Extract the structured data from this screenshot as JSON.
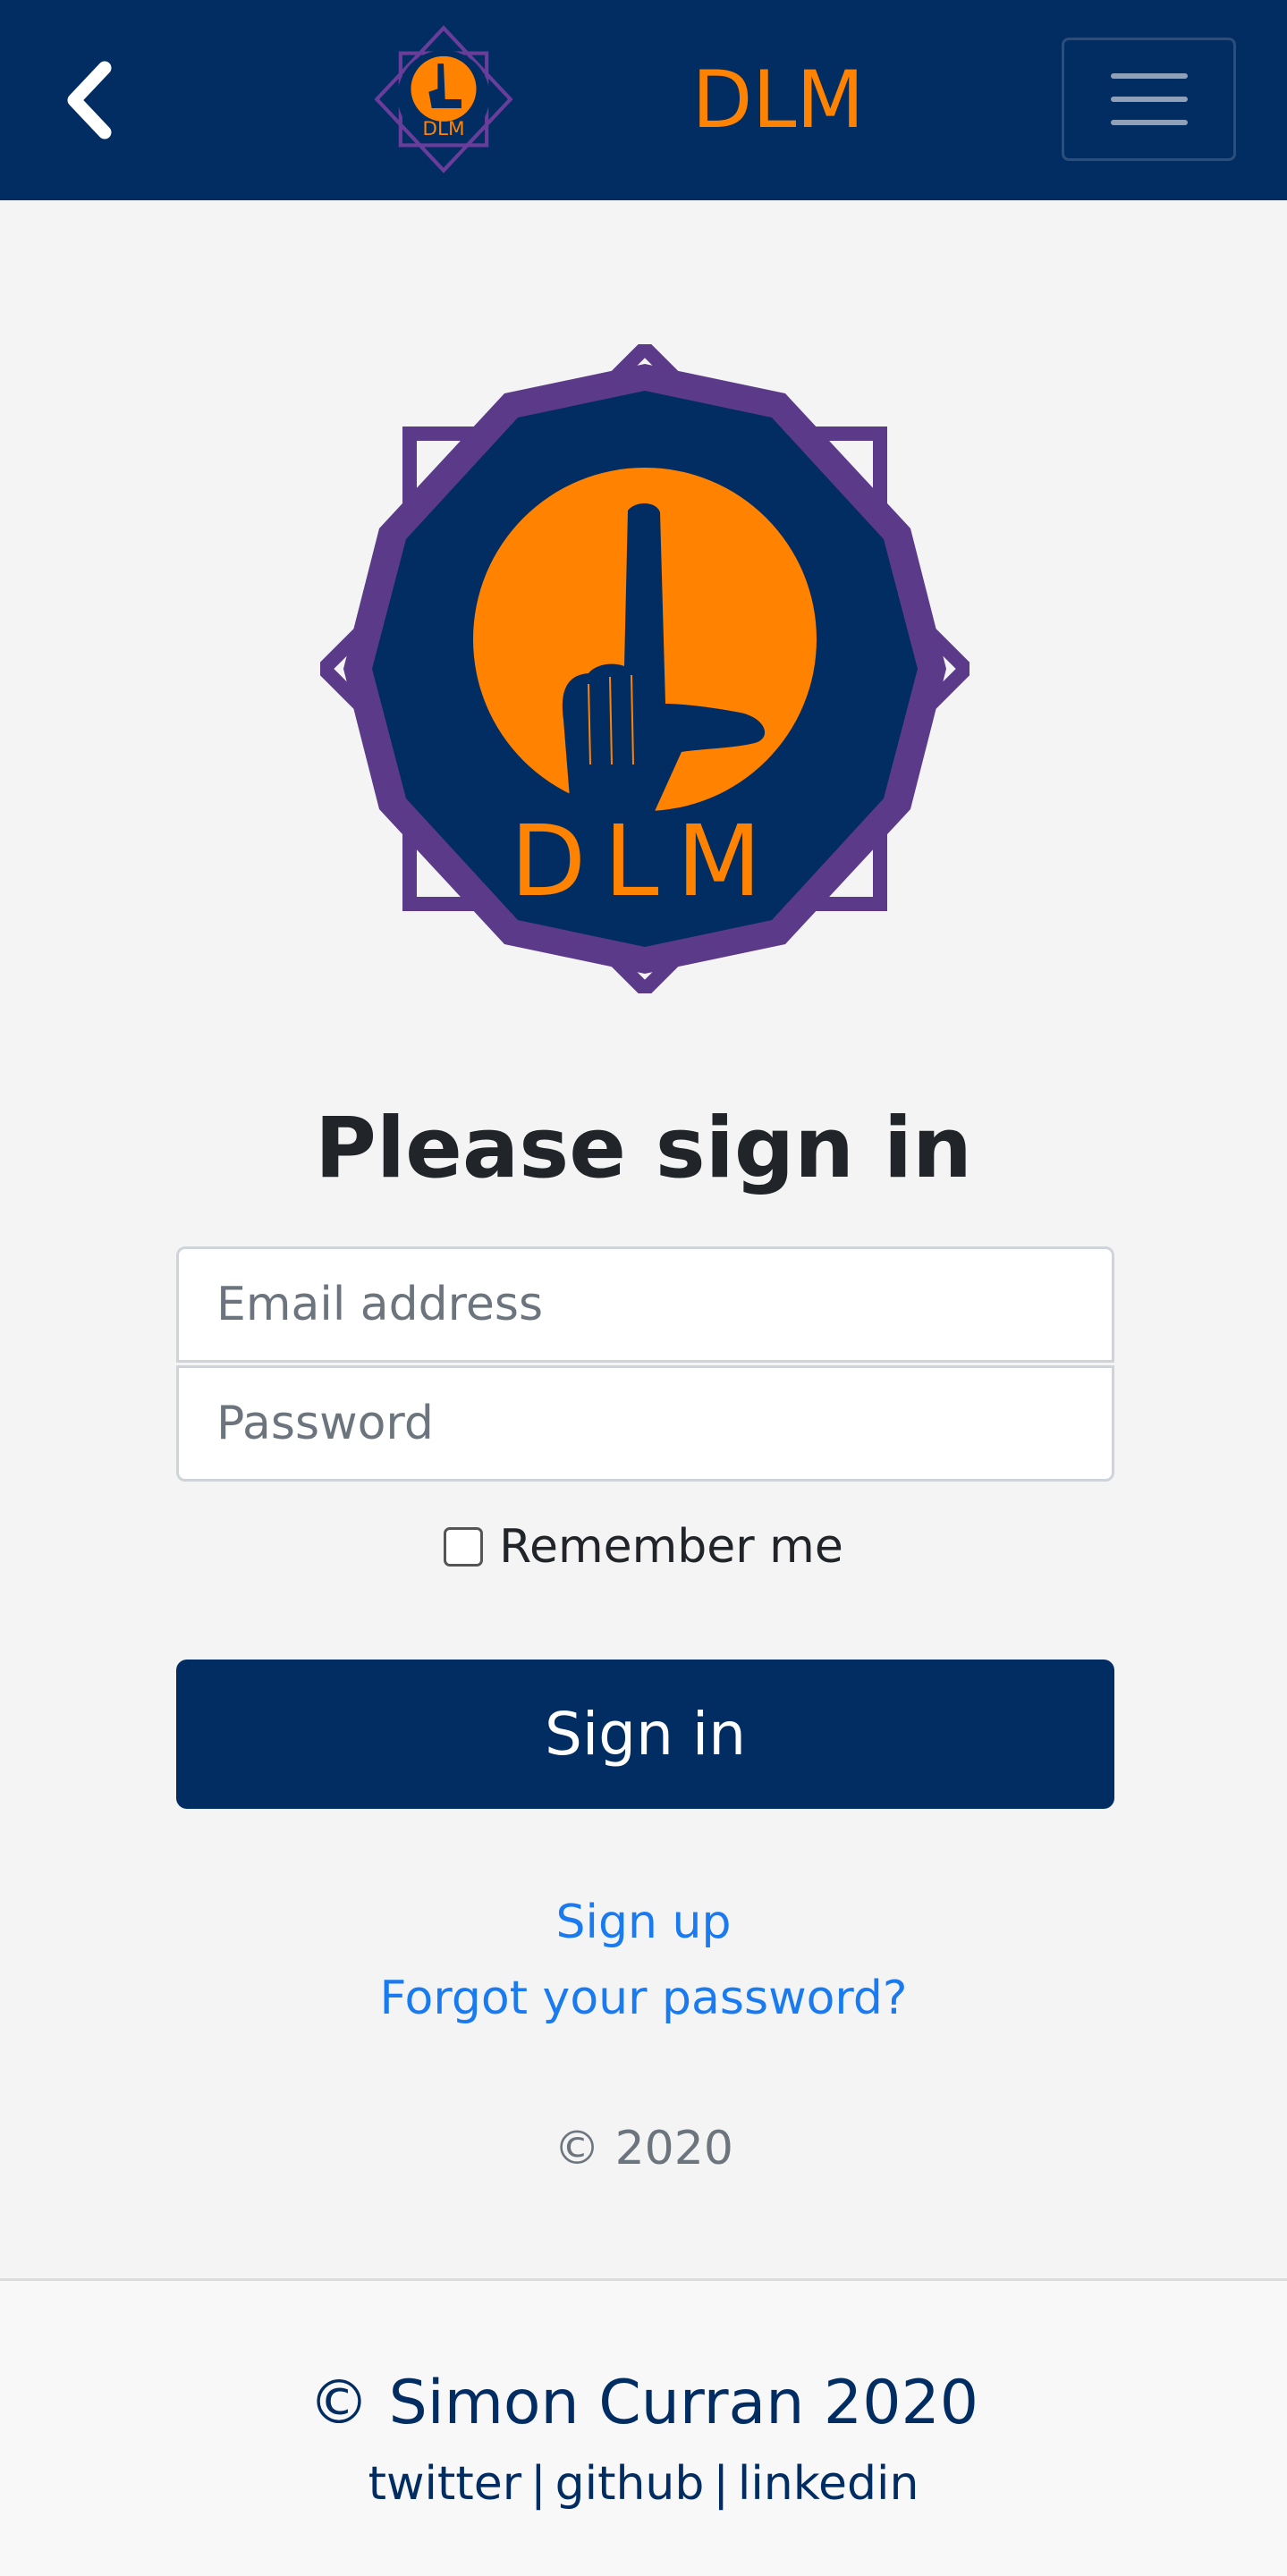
{
  "colors": {
    "navbar_bg": "#022d62",
    "brand": "#ff8300",
    "logo_border": "#5b3a8a",
    "link": "#1a7bf0",
    "button_bg": "#022d62"
  },
  "navbar": {
    "back_icon": "chevron-left-icon",
    "logo_icon": "dlm-logo",
    "logo_text": "DLM",
    "brand": "DLM",
    "menu_icon": "hamburger-icon"
  },
  "logo": {
    "text": "DLM"
  },
  "form": {
    "heading": "Please sign in",
    "email_placeholder": "Email address",
    "email_value": "",
    "password_placeholder": "Password",
    "password_value": "",
    "remember_label": "Remember me",
    "remember_checked": false,
    "submit_label": "Sign in"
  },
  "links": {
    "signup": "Sign up",
    "forgot": "Forgot your password?"
  },
  "copyright": "© 2020",
  "footer": {
    "credit": "© Simon Curran 2020",
    "links": [
      "twitter",
      "github",
      "linkedin"
    ],
    "separator": "|"
  }
}
